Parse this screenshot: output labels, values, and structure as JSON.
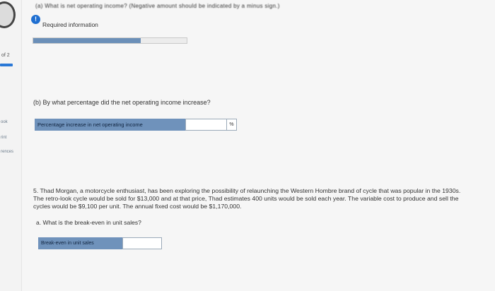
{
  "header": {
    "cut_text": "(a) What is net operating income? (Negative amount should be indicated by a minus sign.)",
    "info_icon": "!",
    "required_info": "Required information",
    "progress_percent": 70
  },
  "sidebar": {
    "counter": "of 2",
    "links": [
      "ook",
      "rint",
      "rences"
    ]
  },
  "part_b": {
    "question": "(b) By what percentage did the net operating income increase?",
    "input_label": "Percentage increase in net operating income",
    "input_value": "",
    "unit": "%"
  },
  "problem5": {
    "text": "5. Thad Morgan, a motorcycle enthusiast, has been exploring the possibility of relaunching the Western Hombre brand of cycle that was popular in the 1930s. The retro-look cycle would be sold for $13,000 and at that price, Thad estimates 400 units would be sold each year. The variable cost to produce and sell the cycles would be $9,100 per unit. The annual fixed cost would be $1,170,000.",
    "question_a": "a. What is the break-even in unit sales?",
    "input_label": "Break-even in unit sales",
    "input_value": ""
  },
  "colors": {
    "accent": "#2a78d6",
    "label_bg": "#6f92bb",
    "progress_fill": "#6b8fb8"
  }
}
